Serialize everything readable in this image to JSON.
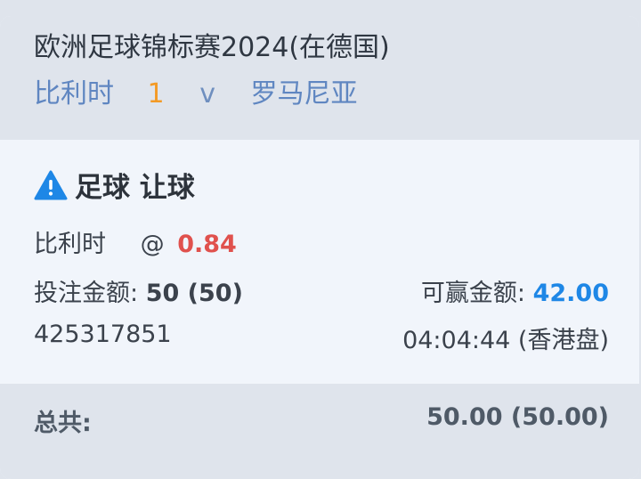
{
  "event": {
    "title": "欧洲足球锦标赛2024(在德国)",
    "home_team": "比利时",
    "score": "1",
    "vs": "v",
    "away_team": "罗马尼亚"
  },
  "bet": {
    "type": "足球 让球",
    "warning_icon": "warning-triangle-icon",
    "selection": "比利时",
    "at": "@",
    "odds": "0.84",
    "stake_label": "投注金额:",
    "stake_value": "50 (50)",
    "win_label": "可赢金额:",
    "win_value": "42.00",
    "ref_id": "425317851",
    "time_info": "04:04:44 (香港盘)"
  },
  "totals": {
    "label": "总共:",
    "value": "50.00 (50.00)"
  },
  "colors": {
    "accent_blue": "#1e87e6",
    "odds_red": "#e0514d",
    "score_orange": "#f39a26"
  }
}
